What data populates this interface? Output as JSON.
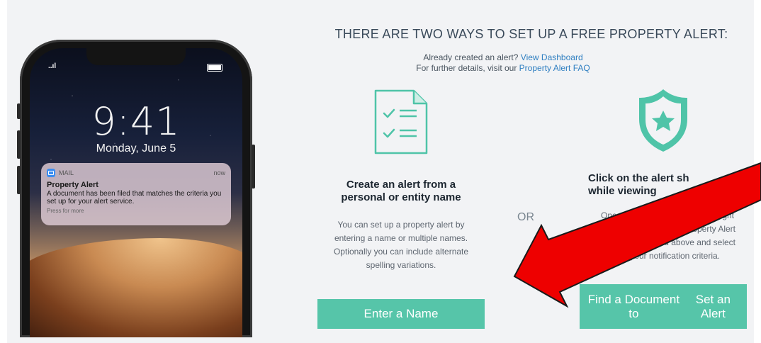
{
  "phone": {
    "status_signal": "..ıl",
    "time": "9:41",
    "date": "Monday, June 5",
    "notification": {
      "app": "MAIL",
      "time": "now",
      "title": "Property Alert",
      "body": "A document has been filed that matches the criteria you set up for your alert service.",
      "hint": "Press for more"
    }
  },
  "header": {
    "title": "THERE ARE TWO WAYS TO SET UP A FREE PROPERTY ALERT:",
    "line1_text": "Already created an alert? ",
    "line1_link": "View Dashboard",
    "line2_text": "For further details, visit our ",
    "line2_link": "Property Alert FAQ"
  },
  "option_name": {
    "icon": "checklist-document-icon",
    "title_line1": "Create an alert from a",
    "title_line2": "personal or entity name",
    "desc_lines": [
      "You can set up a property alert by",
      "entering a name or multiple names.",
      "Optionally you can include alternate",
      "spelling variations."
    ],
    "button": "Enter a Name"
  },
  "separator": "OR",
  "option_document": {
    "icon": "shield-star-icon",
    "title_line1": "Click on the alert sh",
    "title_line2": "while viewing",
    "desc_lines": [
      "Once",
      "operty Alert",
      "nu above and select",
      "your notification criteria."
    ],
    "desc_right": "ght",
    "button_line1": "Find a Document to",
    "button_line2": "Set an Alert"
  },
  "colors": {
    "accent_teal": "#56c5a9",
    "link_blue": "#2f7fc1",
    "arrow_red": "#ee0000",
    "background": "#f2f3f5"
  }
}
